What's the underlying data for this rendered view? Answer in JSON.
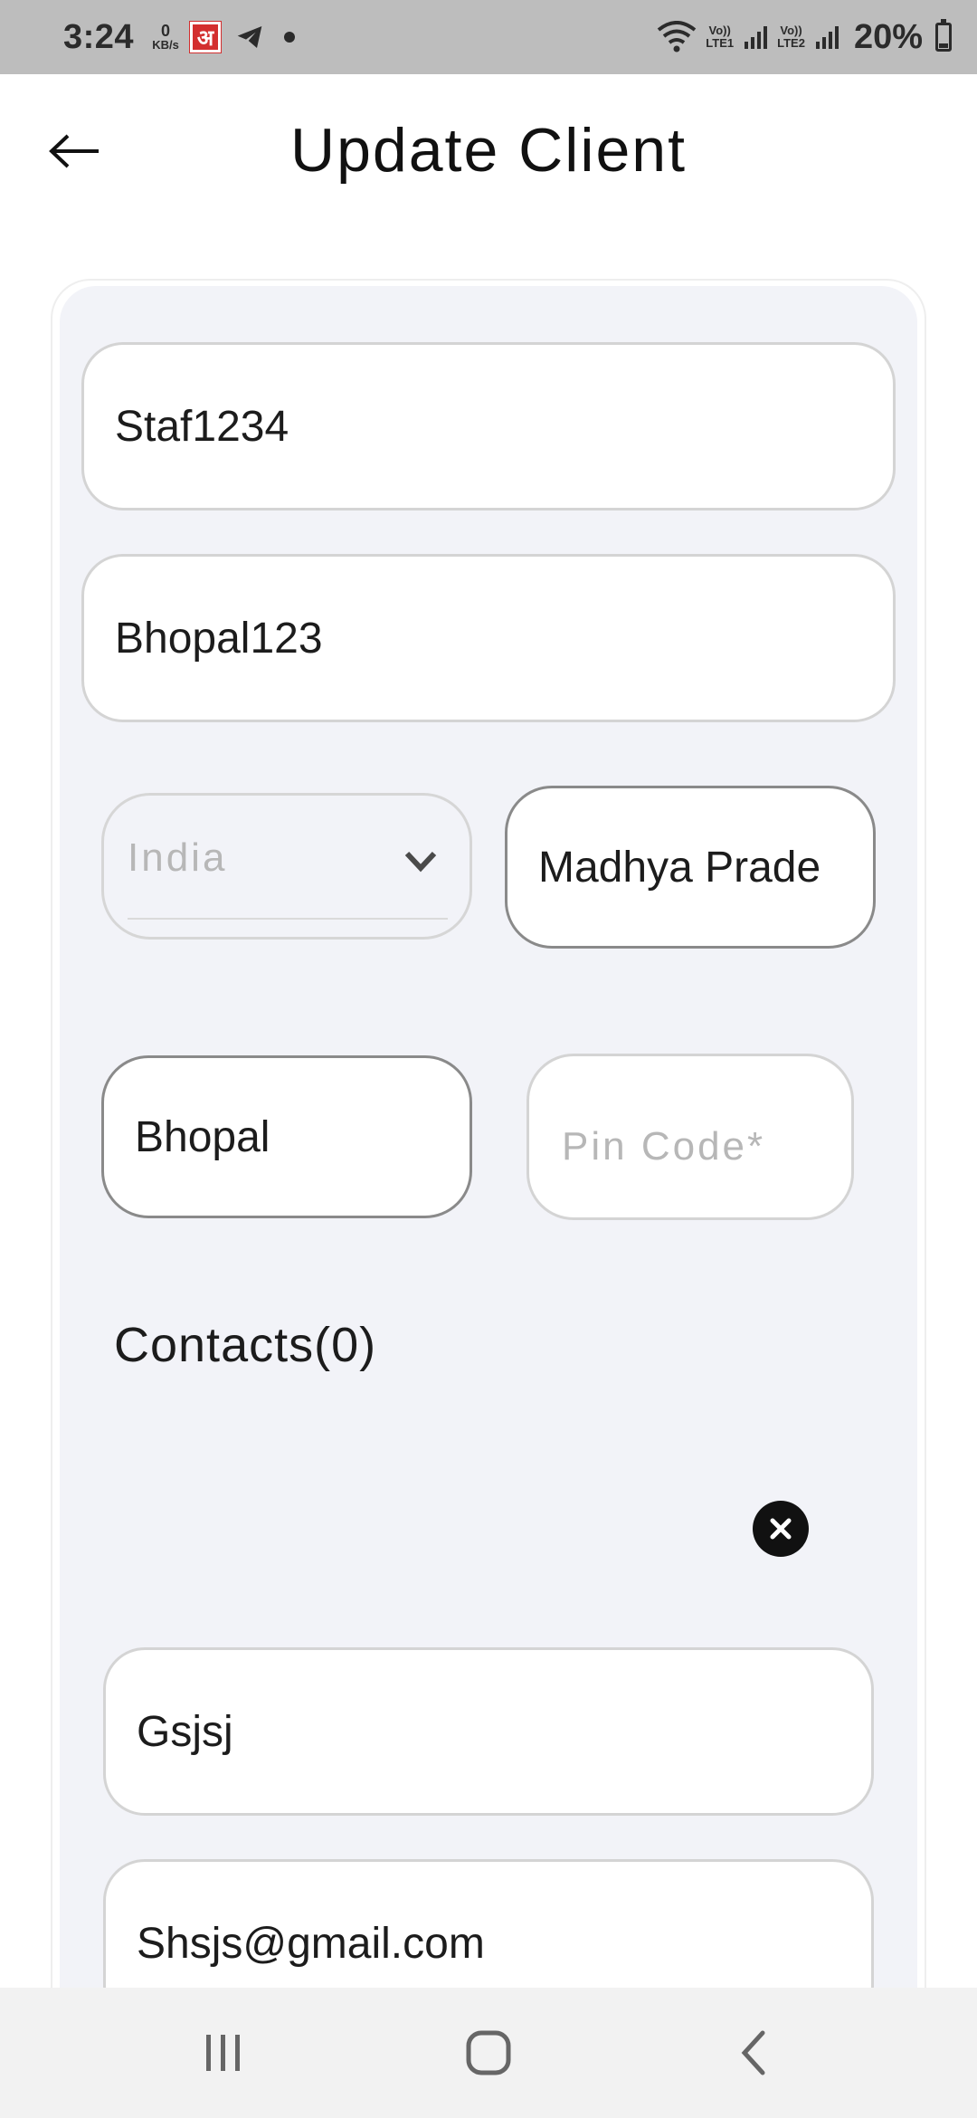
{
  "status_bar": {
    "time": "3:24",
    "net_speed_value": "0",
    "net_speed_unit": "KB/s",
    "app_icon_letter": "अ",
    "sim1_label_top": "Vo))",
    "sim1_label_bottom": "LTE1",
    "sim2_label_top": "Vo))",
    "sim2_label_bottom": "LTE2",
    "battery_percent": "20%"
  },
  "header": {
    "title": "Update Client"
  },
  "form": {
    "client_name_value": "Staf1234",
    "address_value": "Bhopal123",
    "country_value": "India",
    "state_value": "Madhya Prade",
    "city_value": "Bhopal",
    "pincode_placeholder": "Pin Code*",
    "contacts_label": "Contacts(0)",
    "contact_name_value": "Gsjsj",
    "contact_email_value": "Shsjs@gmail.com"
  },
  "nav_bar": {
    "icons": [
      "recent-apps-icon",
      "home-icon",
      "back-icon"
    ]
  }
}
